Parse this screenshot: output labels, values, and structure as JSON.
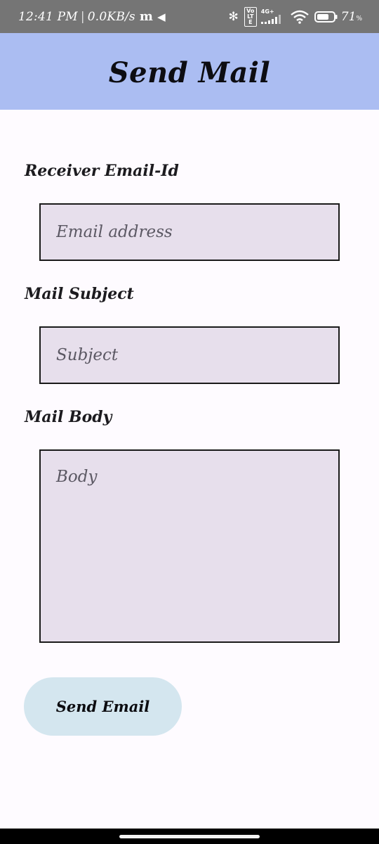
{
  "status_bar": {
    "time": "12:41 PM",
    "separator": "|",
    "net_speed": "0.0KB/s",
    "m_icon_glyph": "m",
    "telegram_icon_glyph": "◀",
    "bluetooth_icon_glyph": "✻",
    "volte_label": "Vo LTE",
    "network_type": "4G+",
    "battery_percent": "71",
    "battery_unit": "%",
    "icons": [
      "m-app-icon",
      "telegram-icon",
      "bluetooth-icon",
      "volte-icon",
      "signal-icon",
      "wifi-icon",
      "battery-icon"
    ]
  },
  "app_bar": {
    "title": "Send Mail",
    "background": "#abbdf2"
  },
  "form": {
    "receiver_label": "Receiver Email-Id",
    "receiver_placeholder": "Email address",
    "receiver_value": "",
    "subject_label": "Mail Subject",
    "subject_placeholder": "Subject",
    "subject_value": "",
    "body_label": "Mail Body",
    "body_placeholder": "Body",
    "body_value": "",
    "field_background": "#e7dfec"
  },
  "actions": {
    "send_label": "Send Email",
    "send_background": "#d4e6ef"
  }
}
